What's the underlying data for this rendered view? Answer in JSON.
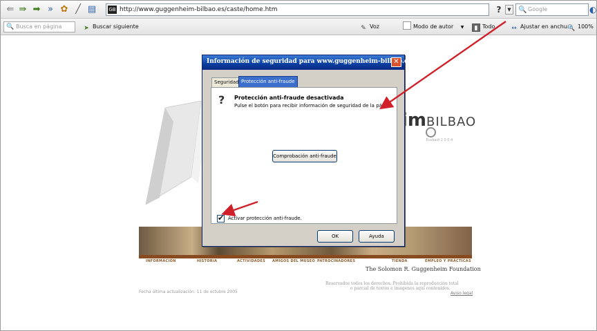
{
  "toolbar": {
    "url": "http://www.guggenheim-bilbao.es/caste/home.htm",
    "favicon_text": "GB",
    "help_glyph": "?",
    "search_placeholder": "Google",
    "icons": [
      "back-icon",
      "forward-icon",
      "double-forward-icon",
      "settings-icon",
      "pencil-icon",
      "page-icon"
    ]
  },
  "findbar": {
    "find_placeholder": "Busca en página",
    "find_next": "Buscar siguiente",
    "voice": "Voz",
    "author_mode": "Modo de autor",
    "all": "Todo",
    "fit_width": "Ajustar en anchura",
    "zoom": "100%"
  },
  "page": {
    "brand_suffix": "im",
    "brand_city": "BILBAO",
    "brand_sub": "Euskadi 2 0 0 4",
    "nav": [
      "INFORMACIÓN",
      "HISTORIA",
      "ACTIVIDADES",
      "AMIGOS DEL MUSEO",
      "PATROCINADORES",
      "TIENDA",
      "EMPLEO Y PRÁCTICAS"
    ],
    "foundation": "The Solomon R. Guggenheim Foundation",
    "rights_line1": "Reservados todos los derechos. Prohibida la reproducción total",
    "rights_line2": "o parcial de textos e imágenes aquí contenidos.",
    "legal": "Aviso legal",
    "updated": "Fecha última actualización: 11 de octubre 2005"
  },
  "dialog": {
    "title": "Información de seguridad para www.guggenheim-bilbao.es",
    "tabs": [
      "Seguridad",
      "Protección anti-fraude"
    ],
    "heading": "Protección anti-fraude desactivada",
    "description": "Pulse el botón para recibir información de seguridad de la página.",
    "check_button": "Comprobación anti-fraude",
    "checkbox_label": "Activar protección anti-fraude.",
    "checkbox_checked": true,
    "ok": "OK",
    "help": "Ayuda"
  },
  "colors": {
    "title_bar": "#0a3ea0",
    "annotation_arrow": "#d0202a",
    "strip_accent": "#8a4a20"
  }
}
